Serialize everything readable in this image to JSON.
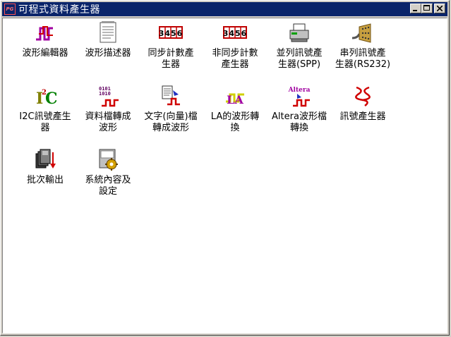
{
  "window": {
    "title": "可程式資料產生器",
    "app_icon": "PG"
  },
  "items": [
    {
      "label": "波形編輯器",
      "icon": "waveform-editor-icon"
    },
    {
      "label": "波形描述器",
      "icon": "waveform-describer-icon"
    },
    {
      "label": "同步計數產\n生器",
      "icon": "sync-counter-icon",
      "digits": "3456"
    },
    {
      "label": "非同步計數\n產生器",
      "icon": "async-counter-icon",
      "digits": "3456"
    },
    {
      "label": "並列訊號產\n生器(SPP)",
      "icon": "parallel-printer-icon"
    },
    {
      "label": "串列訊號產\n生器(RS232)",
      "icon": "serial-connector-icon"
    },
    {
      "label": "I2C訊號產生\n器",
      "icon": "i2c-icon",
      "text": "I²C"
    },
    {
      "label": "資料檔轉成\n波形",
      "icon": "datafile-to-wave-icon",
      "text": "0101\n1010"
    },
    {
      "label": "文字(向量)檔\n轉成波形",
      "icon": "textfile-to-wave-icon"
    },
    {
      "label": "LA的波形轉\n換",
      "icon": "la-convert-icon",
      "text": "LA"
    },
    {
      "label": "Altera波形檔\n轉換",
      "icon": "altera-convert-icon",
      "text": "Altera"
    },
    {
      "label": "訊號產生器",
      "icon": "signal-generator-icon"
    },
    {
      "label": "批次輸出",
      "icon": "batch-output-icon"
    },
    {
      "label": "系統內容及\n設定",
      "icon": "system-settings-icon"
    }
  ]
}
